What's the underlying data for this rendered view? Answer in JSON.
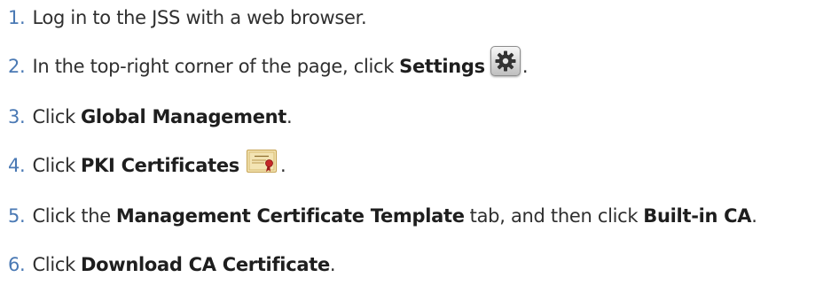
{
  "steps": [
    {
      "number": "1.",
      "text": "Log in to the JSS with a web browser."
    },
    {
      "number": "2.",
      "prefix": "In the top-right corner of the page, click ",
      "bold": "Settings",
      "suffix": ".",
      "icon": "settings-gear-icon"
    },
    {
      "number": "3.",
      "prefix": "Click ",
      "bold": "Global Management",
      "suffix": "."
    },
    {
      "number": "4.",
      "prefix": "Click ",
      "bold": "PKI Certificates",
      "suffix": ".",
      "icon": "certificate-icon"
    },
    {
      "number": "5.",
      "prefix": "Click the ",
      "bold": "Management Certificate Template",
      "middle": " tab, and then click ",
      "bold2": "Built-in CA",
      "suffix": "."
    },
    {
      "number": "6.",
      "prefix": "Click ",
      "bold": "Download CA Certificate",
      "suffix": "."
    }
  ],
  "colors": {
    "number": "#4a79b4",
    "text": "#2f2f2f",
    "bold": "#1e1e1e"
  }
}
